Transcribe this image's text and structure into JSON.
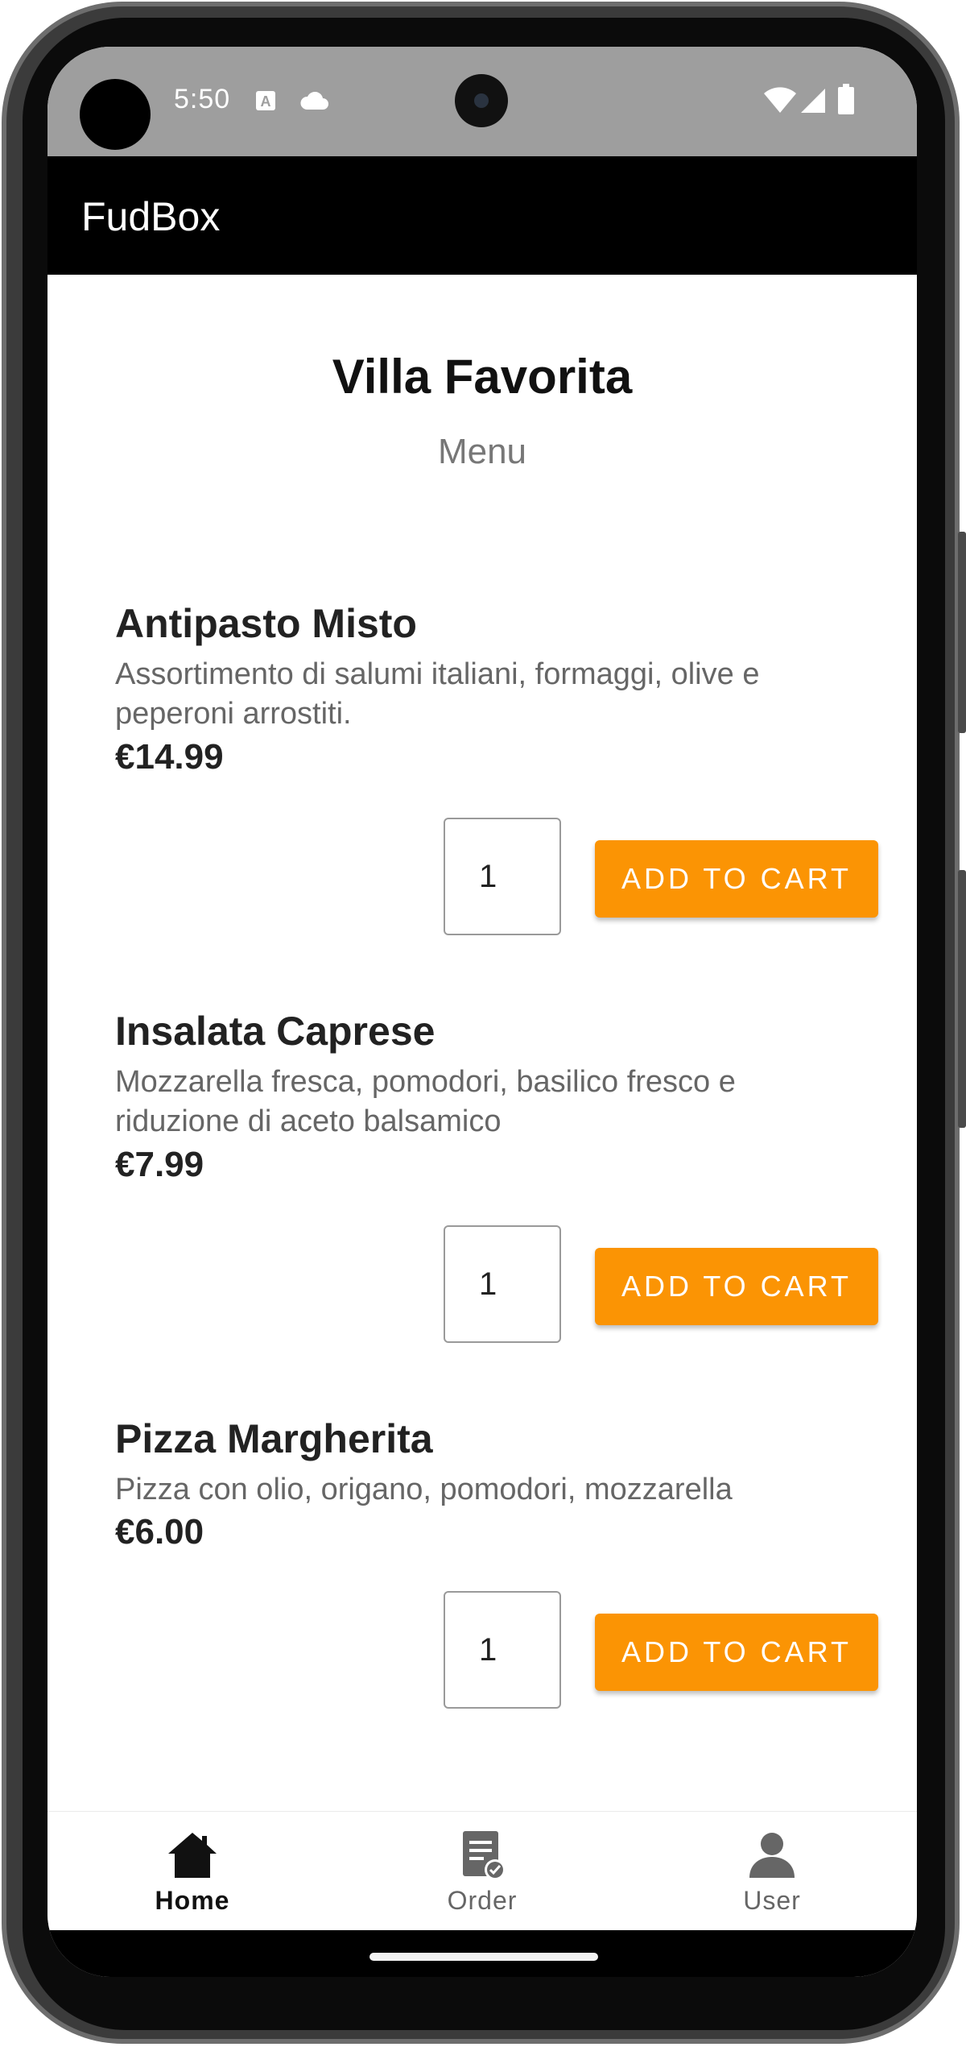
{
  "status_bar": {
    "time": "5:50"
  },
  "app_bar": {
    "title": "FudBox"
  },
  "restaurant": {
    "name": "Villa Favorita",
    "subtitle": "Menu"
  },
  "menu_items": [
    {
      "name": "Antipasto Misto",
      "description": "Assortimento di salumi italiani, formaggi, olive e peperoni arrostiti.",
      "price": "€14.99",
      "quantity": "1",
      "button_label": "ADD TO CART"
    },
    {
      "name": "Insalata Caprese",
      "description": "Mozzarella fresca, pomodori, basilico fresco e riduzione di aceto balsamico",
      "price": "€7.99",
      "quantity": "1",
      "button_label": "ADD TO CART"
    },
    {
      "name": "Pizza Margherita",
      "description": "Pizza con olio, origano, pomodori, mozzarella",
      "price": "€6.00",
      "quantity": "1",
      "button_label": "ADD TO CART"
    }
  ],
  "bottom_nav": {
    "items": [
      {
        "label": "Home",
        "icon": "home-icon",
        "active": true
      },
      {
        "label": "Order",
        "icon": "order-icon",
        "active": false
      },
      {
        "label": "User",
        "icon": "user-icon",
        "active": false
      }
    ]
  },
  "colors": {
    "accent": "#fb9404",
    "app_bar": "#000000",
    "status_bar": "#9e9e9e",
    "nav_active": "#111111",
    "nav_inactive": "#666666"
  }
}
